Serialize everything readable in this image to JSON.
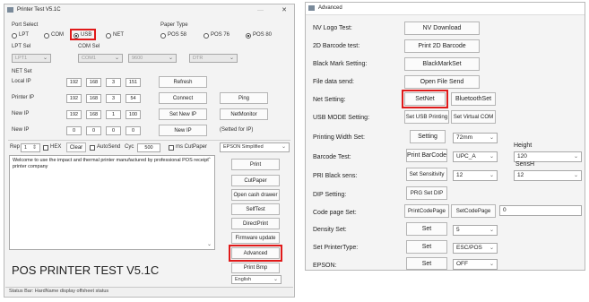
{
  "left": {
    "title": "Printer Test V5.1C",
    "controls": {
      "minimize": "—",
      "close": "✕"
    },
    "port_select": {
      "label": "Port Select",
      "options": [
        "LPT",
        "COM",
        "USB",
        "NET"
      ],
      "selected": "USB"
    },
    "paper_type": {
      "label": "Paper Type",
      "options": [
        "POS 58",
        "POS 76",
        "POS 80"
      ],
      "selected": "POS 80"
    },
    "lpt_sel": {
      "label": "LPT Sel",
      "value": "LPT1"
    },
    "com_sel": {
      "label": "COM Sel",
      "value": "COM1",
      "baud": "9600",
      "flow": "DTR"
    },
    "net_set": {
      "label": "NET Set",
      "rows": [
        {
          "label": "Local IP",
          "ip": [
            "192",
            "168",
            "3",
            "151"
          ],
          "button": "Refresh"
        },
        {
          "label": "Printer IP",
          "ip": [
            "192",
            "168",
            "3",
            "54"
          ],
          "button": "Connect",
          "extra": "Ping"
        },
        {
          "label": "New IP",
          "ip": [
            "192",
            "168",
            "1",
            "100"
          ],
          "button": "Set New IP",
          "extra": "NetMonitor"
        },
        {
          "label": "New IP",
          "ip": [
            "0",
            "0",
            "0",
            "0"
          ],
          "button": "New IP",
          "extra": "(Setted for IP)"
        }
      ]
    },
    "rep": {
      "label": "Rep",
      "value": "1",
      "hex_label": "HEX",
      "clear": "Clear",
      "auto_send": "AutoSend",
      "cyc_label": "Cyc",
      "cyc_value": "500",
      "ms_cutpaper": "ms CutPaper",
      "mode": "EPSON Simplified"
    },
    "memo_text": "Welcome to use the impact and thermal printer manufactured by professional POS receipt printer company",
    "right_buttons": [
      "Print",
      "CutPaper",
      "Open cash drawer",
      "SelfTest",
      "DirectPrint",
      "Firmware update",
      "Advanced",
      "Print Bmp"
    ],
    "language": "English",
    "app_name": "POS PRINTER TEST V5.1C",
    "status": "Status Bar: HardName display offsheet status"
  },
  "right": {
    "title": "Advanced",
    "rows": [
      {
        "label": "NV Logo Test:",
        "buttons": [
          "NV Download"
        ]
      },
      {
        "label": "2D Barcode test:",
        "buttons": [
          "Print 2D Barcode"
        ]
      },
      {
        "label": "Black Mark Setting:",
        "buttons": [
          "BlackMarkSet"
        ]
      },
      {
        "label": "File data send:",
        "buttons": [
          "Open File Send"
        ]
      },
      {
        "label": "Net Setting:",
        "buttons": [
          "SetNet",
          "BluetoothSet"
        ]
      },
      {
        "label": "USB MODE Setting:",
        "buttons": [
          "Set USB Printing",
          "Set Virtual COM"
        ]
      },
      {
        "label": "Printing Width Set:",
        "buttons": [
          "Setting"
        ],
        "dropdown": "72mm"
      },
      {
        "label": "Barcode Test:",
        "buttons": [
          "Print BarCode"
        ],
        "dropdown": "UPC_A",
        "extra_label": "Height",
        "extra_dropdown": "120"
      },
      {
        "label": "PRI Black sens:",
        "buttons": [
          "Set Sensitivity"
        ],
        "dropdown": "12",
        "extra_label": "SensH",
        "extra_dropdown": "12"
      },
      {
        "label": "DIP Setting:",
        "buttons": [
          "PRG Set DIP"
        ]
      },
      {
        "label": "Code page Set:",
        "buttons": [
          "PrintCodePage",
          "SetCodePage"
        ],
        "input": "0"
      },
      {
        "label": "Density Set:",
        "buttons": [
          "Set"
        ],
        "dropdown": "5"
      },
      {
        "label": "Set PrinterType:",
        "buttons": [
          "Set"
        ],
        "dropdown": "ESC/POS"
      },
      {
        "label": "EPSON:",
        "buttons": [
          "Set"
        ],
        "dropdown": "OFF"
      }
    ]
  }
}
